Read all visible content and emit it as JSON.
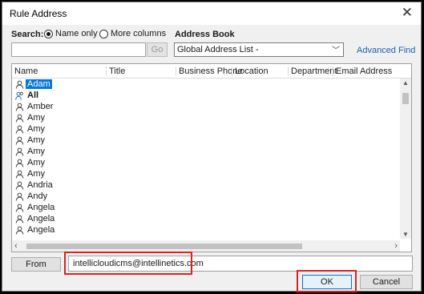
{
  "window": {
    "title": "Rule Address",
    "close_glyph": "✕"
  },
  "search": {
    "label": "Search:",
    "options": [
      {
        "label": "Name only",
        "selected": true
      },
      {
        "label": "More columns",
        "selected": false
      }
    ],
    "input_value": "",
    "go_label": "Go"
  },
  "address_book": {
    "label": "Address Book",
    "selected": "Global Address List -",
    "chevron": "﹀",
    "advanced_find": "Advanced Find"
  },
  "list": {
    "columns": [
      "Name",
      "Title",
      "Business Phone",
      "Location",
      "Department",
      "Email Address"
    ],
    "rows": [
      {
        "name": "Adam",
        "icon": "person-icon",
        "selected": true
      },
      {
        "name": "All",
        "icon": "group-icon",
        "bold": true
      },
      {
        "name": "Amber",
        "icon": "person-icon"
      },
      {
        "name": "Amy",
        "icon": "person-icon"
      },
      {
        "name": "Amy",
        "icon": "person-icon"
      },
      {
        "name": "Amy",
        "icon": "person-icon"
      },
      {
        "name": "Amy",
        "icon": "person-icon"
      },
      {
        "name": "Amy",
        "icon": "person-icon"
      },
      {
        "name": "Amy",
        "icon": "person-icon"
      },
      {
        "name": "Andria",
        "icon": "person-icon"
      },
      {
        "name": "Andy",
        "icon": "person-icon"
      },
      {
        "name": "Angela",
        "icon": "person-icon"
      },
      {
        "name": "Angela",
        "icon": "person-icon"
      },
      {
        "name": "Angela",
        "icon": "person-icon"
      }
    ]
  },
  "from": {
    "button_label": "From",
    "value": "intellicloudicms@intellinetics.com"
  },
  "buttons": {
    "ok": "OK",
    "cancel": "Cancel"
  },
  "colors": {
    "selection": "#0078d7",
    "highlight_box": "#e02020",
    "link": "#1a5fb4"
  }
}
